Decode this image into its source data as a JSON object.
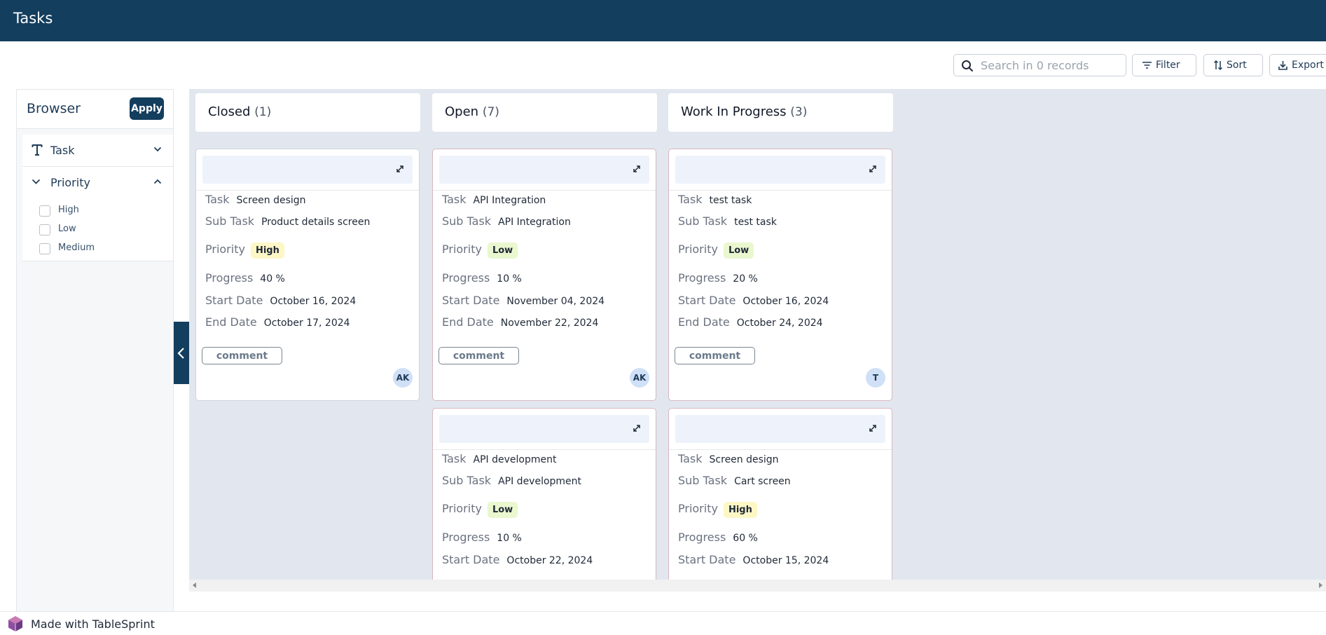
{
  "app": {
    "title": "Tasks"
  },
  "toolbar": {
    "search_placeholder": "Search in 0 records",
    "filter_label": "Filter",
    "sort_label": "Sort",
    "export_label": "Export"
  },
  "sidebar": {
    "title": "Browser",
    "apply_label": "Apply",
    "facets": [
      {
        "label": "Task",
        "icon": "text-type-icon",
        "expanded": false
      },
      {
        "label": "Priority",
        "icon": "chevron-down-icon",
        "expanded": true,
        "options": [
          "High",
          "Low",
          "Medium"
        ]
      }
    ]
  },
  "colors": {
    "brand": "#133e5e",
    "board_bg": "#e2e7ef",
    "pill_high": "#fdf7c6",
    "pill_low": "#eaf7cf"
  },
  "columns": [
    {
      "title": "Closed",
      "count": "(1)",
      "cards": [
        {
          "task": "Screen design",
          "subtask": "Product details screen",
          "priority": "High",
          "progress": "40 %",
          "start": "October 16, 2024",
          "end": "October 17, 2024",
          "comment": "comment",
          "avatar": "AK"
        }
      ]
    },
    {
      "title": "Open",
      "count": "(7)",
      "cards": [
        {
          "task": "API Integration",
          "subtask": "API Integration",
          "priority": "Low",
          "progress": "10 %",
          "start": "November 04, 2024",
          "end": "November 22, 2024",
          "comment": "comment",
          "avatar": "AK"
        },
        {
          "task": "API development",
          "subtask": "API development",
          "priority": "Low",
          "progress": "10 %",
          "start": "October 22, 2024"
        }
      ]
    },
    {
      "title": "Work In Progress",
      "count": "(3)",
      "cards": [
        {
          "task": "test task",
          "subtask": "test task",
          "priority": "Low",
          "progress": "20 %",
          "start": "October 16, 2024",
          "end": "October 24, 2024",
          "comment": "comment",
          "avatar": "T"
        },
        {
          "task": "Screen design",
          "subtask": "Cart screen",
          "priority": "High",
          "progress": "60 %",
          "start": "October 15, 2024"
        }
      ]
    }
  ],
  "labels": {
    "task": "Task",
    "subtask": "Sub Task",
    "priority": "Priority",
    "progress": "Progress",
    "start": "Start Date",
    "end": "End Date"
  },
  "footer": {
    "text": "Made with TableSprint"
  }
}
